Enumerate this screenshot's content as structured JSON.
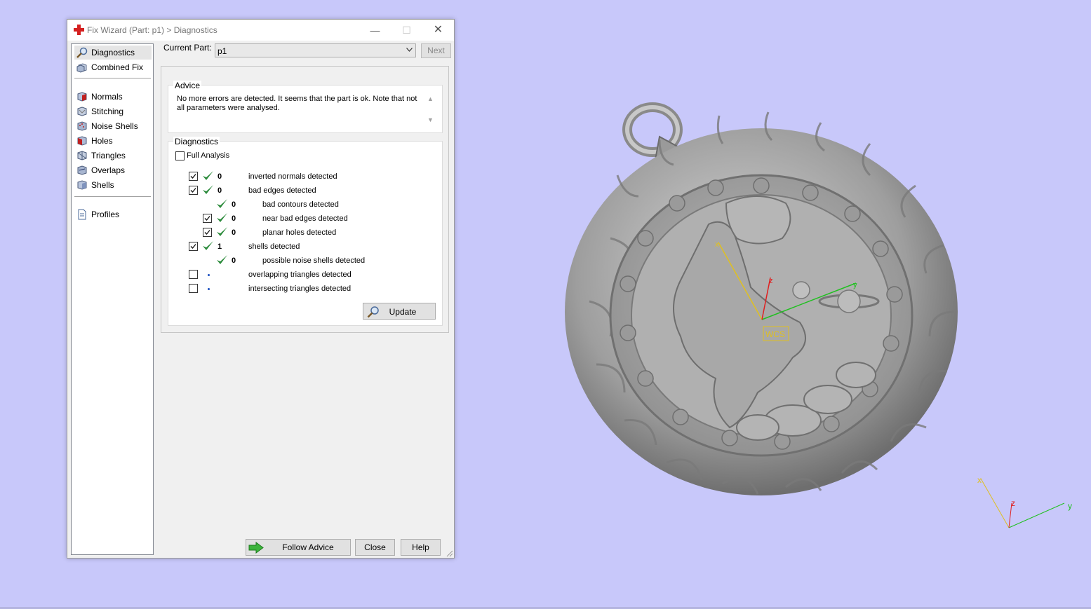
{
  "window": {
    "title": "Fix Wizard (Part: p1) > Diagnostics",
    "minimize_glyph": "—",
    "maximize_glyph": "☐",
    "close_glyph": "✕"
  },
  "nav": {
    "items": [
      {
        "label": "Diagnostics",
        "icon": "magnifier-icon",
        "selected": true
      },
      {
        "label": "Combined Fix",
        "icon": "cube-stack-icon"
      },
      {
        "label": "Normals",
        "icon": "cube-red-face-icon"
      },
      {
        "label": "Stitching",
        "icon": "cube-stitch-icon"
      },
      {
        "label": "Noise Shells",
        "icon": "cube-noise-icon"
      },
      {
        "label": "Holes",
        "icon": "cube-hole-icon"
      },
      {
        "label": "Triangles",
        "icon": "cube-triangles-icon"
      },
      {
        "label": "Overlaps",
        "icon": "cube-overlap-icon"
      },
      {
        "label": "Shells",
        "icon": "cube-shells-icon"
      },
      {
        "label": "Profiles",
        "icon": "document-icon"
      }
    ]
  },
  "current_part": {
    "label": "Current Part:",
    "value": "p1",
    "next_label": "Next"
  },
  "advice": {
    "title": "Advice",
    "text": "No more errors are detected. It seems that the part is ok. Note that not all parameters were analysed."
  },
  "diagnostics": {
    "title": "Diagnostics",
    "full_analysis_label": "Full Analysis",
    "full_analysis_checked": false,
    "rows": [
      {
        "label": "inverted normals detected",
        "count": "0",
        "checked": true,
        "status": "ok"
      },
      {
        "label": "bad edges detected",
        "count": "0",
        "checked": true,
        "status": "ok"
      },
      {
        "label": "bad contours detected",
        "count": "0",
        "status": "ok"
      },
      {
        "label": "near bad edges detected",
        "count": "0",
        "checked": true,
        "status": "ok"
      },
      {
        "label": "planar holes detected",
        "count": "0",
        "checked": true,
        "status": "ok"
      },
      {
        "label": "shells detected",
        "count": "1",
        "checked": true,
        "status": "ok"
      },
      {
        "label": "possible noise shells detected",
        "count": "0",
        "status": "ok"
      },
      {
        "label": "overlapping triangles detected",
        "count": "",
        "checked": false,
        "status": "pending"
      },
      {
        "label": "intersecting triangles detected",
        "count": "",
        "checked": false,
        "status": "pending"
      }
    ],
    "update_label": "Update"
  },
  "buttons": {
    "follow_advice": "Follow Advice",
    "close": "Close",
    "help": "Help"
  },
  "viewport": {
    "wcs_label": "WCS",
    "axis_x": "x",
    "axis_y": "y",
    "axis_z": "z"
  },
  "colors": {
    "desktop_bg": "#c8c8fa",
    "check_green": "#2a8a3a",
    "axis_x": "#e0c020",
    "axis_y": "#20c020",
    "axis_z": "#e02020"
  }
}
